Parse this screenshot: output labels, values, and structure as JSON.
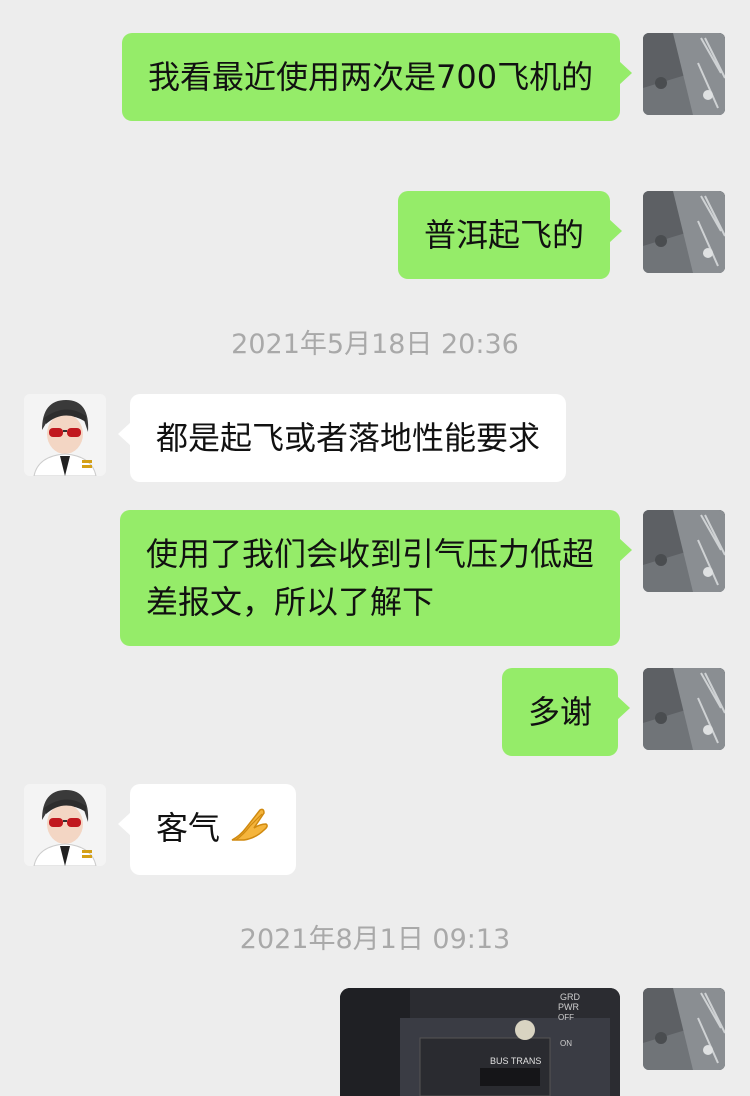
{
  "messages": [
    {
      "text": "我看最近使用两次是700飞机的"
    },
    {
      "text": "普洱起飞的"
    },
    {
      "timestamp": "2021年5月18日 20:36"
    },
    {
      "text": "都是起飞或者落地性能要求"
    },
    {
      "text": "使用了我们会收到引气压力低超差报文，所以了解下"
    },
    {
      "text": "多谢"
    },
    {
      "text": "客气",
      "emoji": "palms-together-icon"
    },
    {
      "timestamp": "2021年8月1日 09:13"
    }
  ],
  "photo_labels": {
    "line1": "GRD",
    "line2": "PWR",
    "line3": "OFF",
    "line4": "ON",
    "line5": "BUS TRANS"
  },
  "colors": {
    "background": "#ededed",
    "my_bubble": "#95ec69",
    "their_bubble": "#ffffff",
    "timestamp": "#a9a9a9"
  }
}
